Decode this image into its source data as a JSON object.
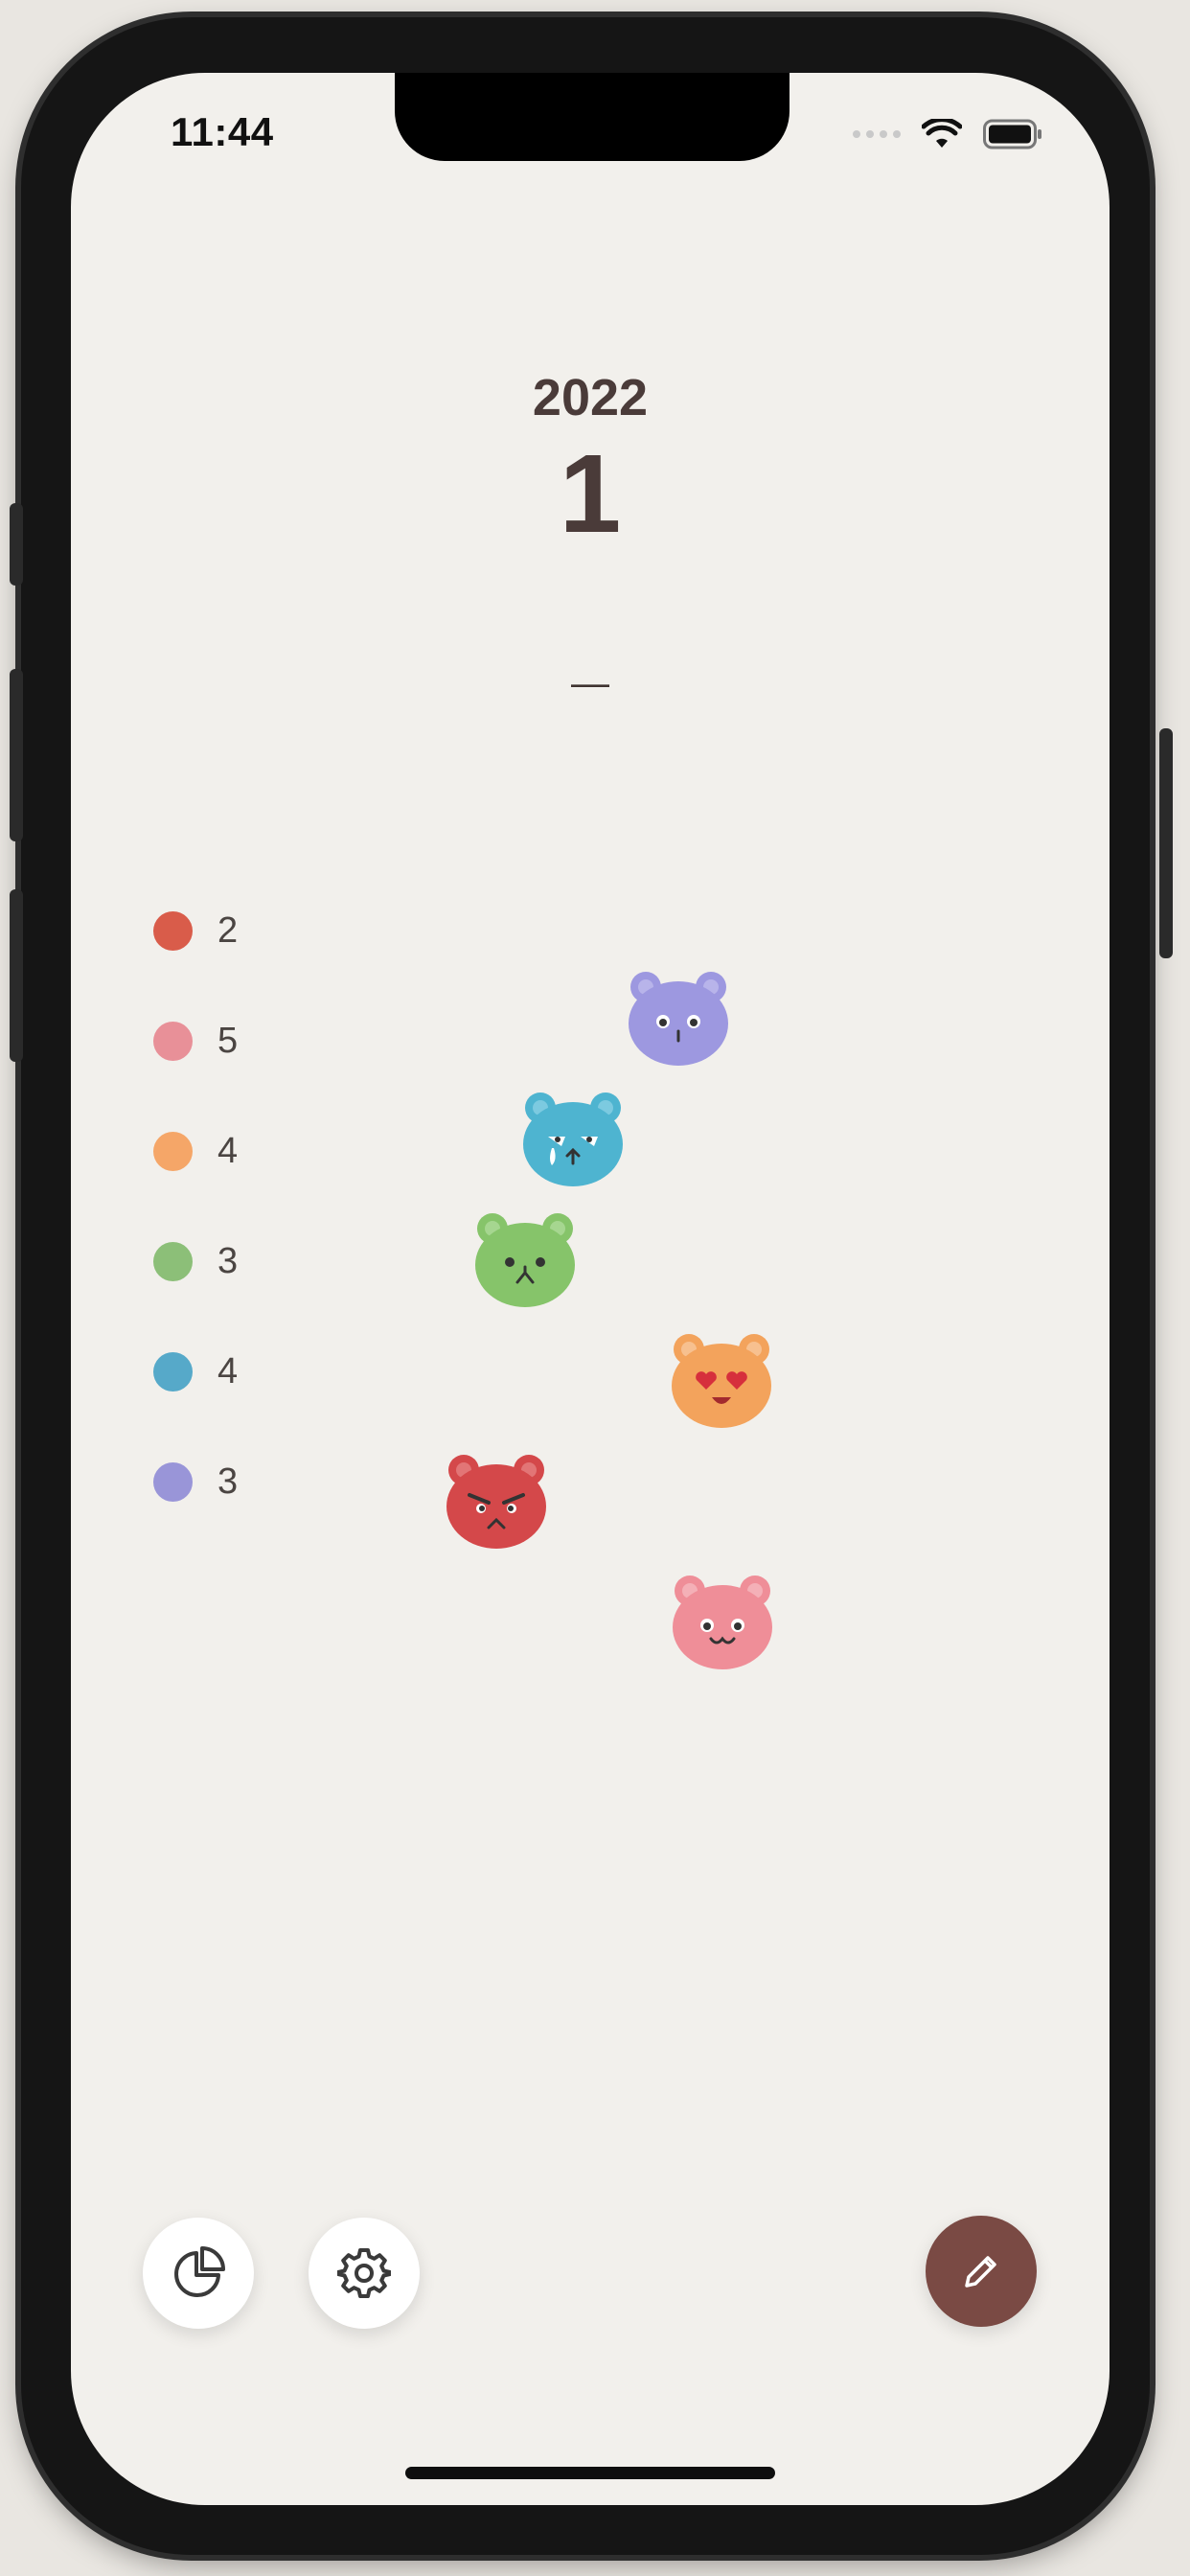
{
  "status_bar": {
    "time": "11:44"
  },
  "header": {
    "year": "2022",
    "month": "1",
    "separator": "—"
  },
  "legend": [
    {
      "count": "2",
      "color": "#d95c4a",
      "mood": "angry"
    },
    {
      "count": "5",
      "color": "#e89098",
      "mood": "happy"
    },
    {
      "count": "4",
      "color": "#f5a668",
      "mood": "in-love"
    },
    {
      "count": "3",
      "color": "#8cbf78",
      "mood": "sad"
    },
    {
      "count": "4",
      "color": "#56a9c9",
      "mood": "crying"
    },
    {
      "count": "3",
      "color": "#9995d8",
      "mood": "calm"
    }
  ],
  "bears": [
    {
      "mood": "calm",
      "color": "#9d98e0"
    },
    {
      "mood": "crying",
      "color": "#4eb4d0"
    },
    {
      "mood": "sad",
      "color": "#86c46a"
    },
    {
      "mood": "in-love",
      "color": "#f3a35c"
    },
    {
      "mood": "angry",
      "color": "#d4484a"
    },
    {
      "mood": "happy",
      "color": "#ef8e98"
    }
  ],
  "toolbar": {
    "stats_icon": "pie-chart-icon",
    "settings_icon": "gear-icon",
    "edit_icon": "pencil-icon",
    "edit_color": "#7a4a44"
  }
}
